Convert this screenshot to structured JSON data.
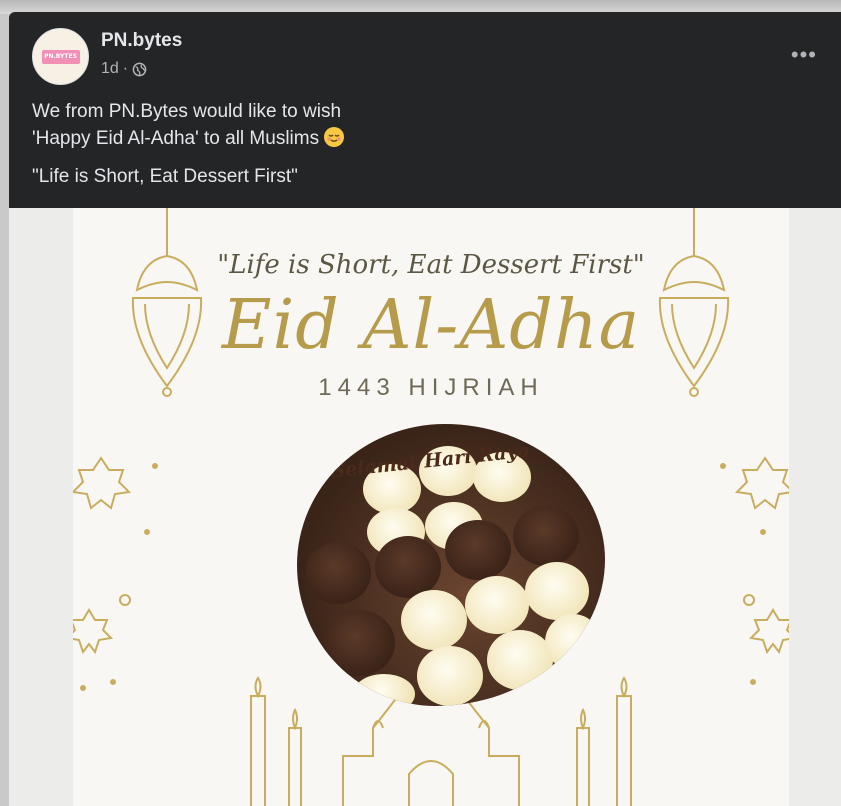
{
  "post": {
    "author": "PN.bytes",
    "time": "1d",
    "time_separator": "·",
    "avatar_text": "PN.BYTES",
    "text_line1": "We from PN.Bytes would like to wish",
    "text_line2": "'Happy Eid Al-Adha' to all Muslims",
    "text_line3": "\"Life is Short, Eat Dessert First\"",
    "more_menu": "•••"
  },
  "image": {
    "quote": "\"Life is Short, Eat Dessert First\"",
    "title": "Eid Al-Adha",
    "subtitle": "1443 HIJRIAH",
    "cake_text": "Selamat Hari Raya"
  },
  "colors": {
    "post_bg": "#242526",
    "gold": "#b59b4a"
  }
}
